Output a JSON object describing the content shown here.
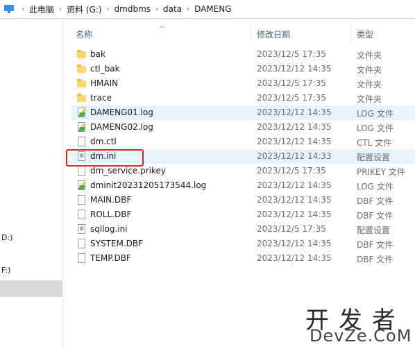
{
  "breadcrumb": [
    "此电脑",
    "资料 (G:)",
    "dmdbms",
    "data",
    "DAMENG"
  ],
  "columns": {
    "name": "名称",
    "date": "修改日期",
    "type": "类型"
  },
  "nav": {
    "drive_d": "D:)",
    "drive_f": "F:)"
  },
  "files": [
    {
      "name": "bak",
      "date": "2023/12/5 17:35",
      "type": "文件夹",
      "icon": "folder-icon"
    },
    {
      "name": "ctl_bak",
      "date": "2023/12/12 14:35",
      "type": "文件夹",
      "icon": "folder-icon"
    },
    {
      "name": "HMAIN",
      "date": "2023/12/5 17:35",
      "type": "文件夹",
      "icon": "folder-icon"
    },
    {
      "name": "trace",
      "date": "2023/12/5 17:35",
      "type": "文件夹",
      "icon": "folder-icon"
    },
    {
      "name": "DAMENG01.log",
      "date": "2023/12/12 14:35",
      "type": "LOG 文件",
      "icon": "log-file-icon"
    },
    {
      "name": "DAMENG02.log",
      "date": "2023/12/12 14:35",
      "type": "LOG 文件",
      "icon": "log-file-icon"
    },
    {
      "name": "dm.ctl",
      "date": "2023/12/12 14:35",
      "type": "CTL 文件",
      "icon": "file-icon"
    },
    {
      "name": "dm.ini",
      "date": "2023/12/12 14:33",
      "type": "配置设置",
      "icon": "ini-file-icon"
    },
    {
      "name": "dm_service.prikey",
      "date": "2023/12/5 17:35",
      "type": "PRIKEY 文件",
      "icon": "file-icon"
    },
    {
      "name": "dminit20231205173544.log",
      "date": "2023/12/12 14:35",
      "type": "LOG 文件",
      "icon": "log-file-icon"
    },
    {
      "name": "MAIN.DBF",
      "date": "2023/12/12 14:35",
      "type": "DBF 文件",
      "icon": "file-icon"
    },
    {
      "name": "ROLL.DBF",
      "date": "2023/12/12 14:35",
      "type": "DBF 文件",
      "icon": "file-icon"
    },
    {
      "name": "sqllog.ini",
      "date": "2023/12/5 17:35",
      "type": "配置设置",
      "icon": "ini-file-icon"
    },
    {
      "name": "SYSTEM.DBF",
      "date": "2023/12/12 14:35",
      "type": "DBF 文件",
      "icon": "file-icon"
    },
    {
      "name": "TEMP.DBF",
      "date": "2023/12/12 14:35",
      "type": "DBF 文件",
      "icon": "file-icon"
    }
  ],
  "watermark": {
    "line1": "开发者",
    "line2": "DevZe.CoM"
  }
}
